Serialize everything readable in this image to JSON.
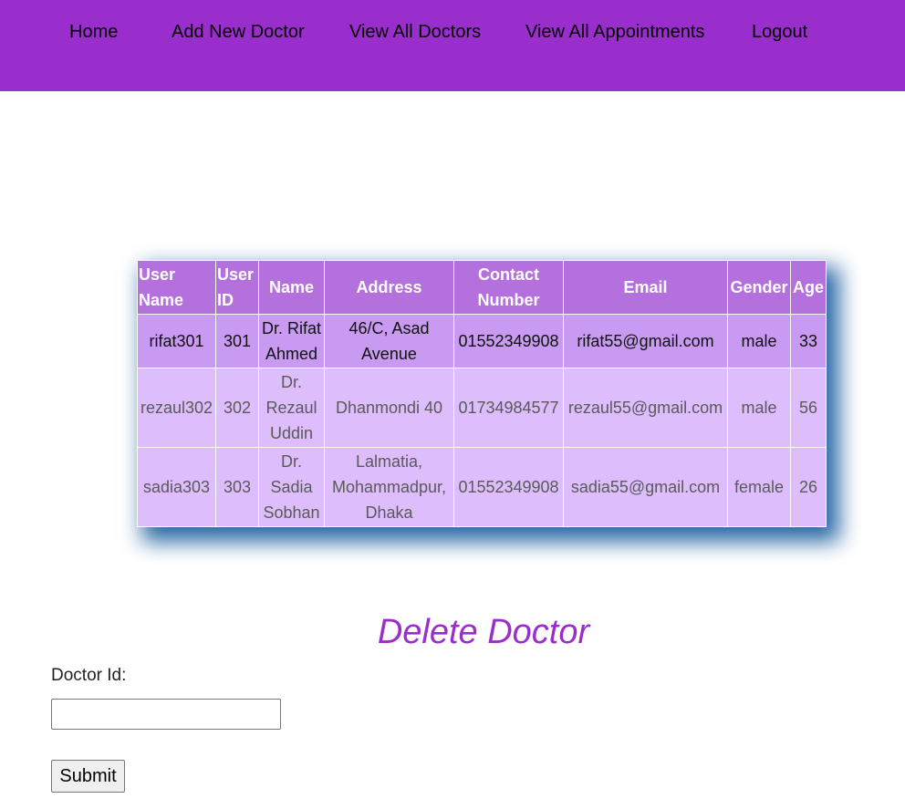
{
  "nav": {
    "home": "Home",
    "add_new_doctor": "Add New Doctor",
    "view_all_doctors": "View All Doctors",
    "view_all_appointments": "View All Appointments",
    "logout": "Logout"
  },
  "table": {
    "headers": {
      "user_name_1": "User",
      "user_name_2": "Name",
      "user_id_1": "User",
      "user_id_2": "ID",
      "name": "Name",
      "address": "Address",
      "contact_1": "Contact",
      "contact_2": "Number",
      "email": "Email",
      "gender": "Gender",
      "age": "Age"
    },
    "rows": [
      {
        "user_name": "rifat301",
        "user_id": "301",
        "name_1": "Dr. Rifat",
        "name_2": "Ahmed",
        "address_1": "46/C, Asad",
        "address_2": "Avenue",
        "contact": "01552349908",
        "email": "rifat55@gmail.com",
        "gender": "male",
        "age": "33"
      },
      {
        "user_name": "rezaul302",
        "user_id": "302",
        "name_1": "Dr.",
        "name_2": "Rezaul",
        "name_3": "Uddin",
        "address_1": "Dhanmondi 40",
        "contact": "01734984577",
        "email": "rezaul55@gmail.com",
        "gender": "male",
        "age": "56"
      },
      {
        "user_name": "sadia303",
        "user_id": "303",
        "name_1": "Dr.",
        "name_2": "Sadia",
        "name_3": "Sobhan",
        "address_1": "Lalmatia,",
        "address_2": "Mohammadpur,",
        "address_3": "Dhaka",
        "contact": "01552349908",
        "email": "sadia55@gmail.com",
        "gender": "female",
        "age": "26"
      }
    ]
  },
  "delete_form": {
    "title": "Delete Doctor",
    "label": "Doctor Id:",
    "input_value": "",
    "submit_label": "Submit"
  },
  "colors": {
    "nav_bg": "#9a2ecc",
    "header_bg": "#b470dc",
    "first_row_bg": "#c99af1",
    "row_bg": "#ddbdfc",
    "title_color": "#9a2ecc",
    "shadow": "#2a6aa5"
  }
}
